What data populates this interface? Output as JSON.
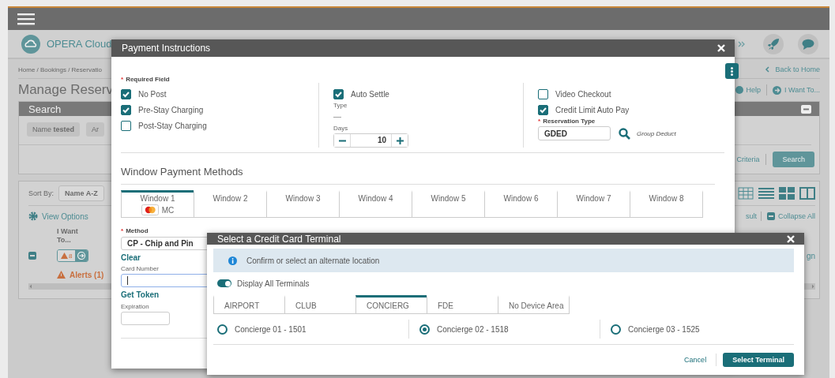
{
  "header": {
    "product": "OPERA Cloud"
  },
  "page": {
    "breadcrumb": "Home / Bookings / Reservatio",
    "back_link": "Back to Home",
    "title": "Manage Reserv",
    "help_link": "Help",
    "i_want_to_link": "I Want To...",
    "search_panel": {
      "title": "Search",
      "chips": [
        "Name **tested**",
        "Ar"
      ],
      "criteria_link": "Criteria",
      "search_button": "Search"
    },
    "results": {
      "sort_label": "Sort By:",
      "sort_value": "Name A-Z",
      "view_options": "View Options",
      "result_link": "sult",
      "collapse_all": "Collapse All",
      "column_header": "I Want To...",
      "alert_count": "8",
      "alerts_link": "Alerts (1)",
      "cell_link": "gn"
    }
  },
  "payment_dialog": {
    "title": "Payment Instructions",
    "required_mark": "*",
    "required_note": "Required Field",
    "options": [
      {
        "label": "No Post",
        "checked": true
      },
      {
        "label": "Pre-Stay Charging",
        "checked": true
      },
      {
        "label": "Post-Stay Charging",
        "checked": false
      }
    ],
    "auto_settle": {
      "label": "Auto Settle",
      "checked": true
    },
    "type_label": "Type",
    "type_value": "—",
    "days_label": "Days",
    "days_value": "10",
    "options_right": [
      {
        "label": "Video Checkout",
        "checked": false
      },
      {
        "label": "Credit Limit Auto Pay",
        "checked": true
      }
    ],
    "reservation_type": {
      "mark": "*",
      "label": "Reservation Type",
      "value": "GDED",
      "description": "Group Deduct"
    },
    "section_title": "Window Payment Methods",
    "windows": [
      {
        "label": "Window 1",
        "selected": true,
        "card": "MC"
      },
      {
        "label": "Window 2",
        "selected": false
      },
      {
        "label": "Window 3",
        "selected": false
      },
      {
        "label": "Window 4",
        "selected": false
      },
      {
        "label": "Window 5",
        "selected": false
      },
      {
        "label": "Window 6",
        "selected": false
      },
      {
        "label": "Window 7",
        "selected": false
      },
      {
        "label": "Window 8",
        "selected": false
      }
    ],
    "method": {
      "mark": "*",
      "label": "Method",
      "value": "CP - Chip and Pin"
    },
    "clear_link": "Clear",
    "card_number_label": "Card Number",
    "get_token_link": "Get Token",
    "expiration_label": "Expiration"
  },
  "terminal_dialog": {
    "title": "Select a Credit Card Terminal",
    "info": "Confirm or select an alternate location",
    "display_all": {
      "label": "Display All Terminals",
      "on": true
    },
    "areas": [
      {
        "label": "AIRPORT",
        "selected": false
      },
      {
        "label": "CLUB",
        "selected": false
      },
      {
        "label": "CONCIERG",
        "selected": true
      },
      {
        "label": "FDE",
        "selected": false
      },
      {
        "label": "No Device Area",
        "selected": false
      }
    ],
    "terminals": [
      {
        "label": "Concierge 01 - 1501",
        "selected": false
      },
      {
        "label": "Concierge 02 - 1518",
        "selected": true
      },
      {
        "label": "Concierge 03 - 1525",
        "selected": false
      }
    ],
    "cancel": "Cancel",
    "select_button": "Select Terminal"
  }
}
